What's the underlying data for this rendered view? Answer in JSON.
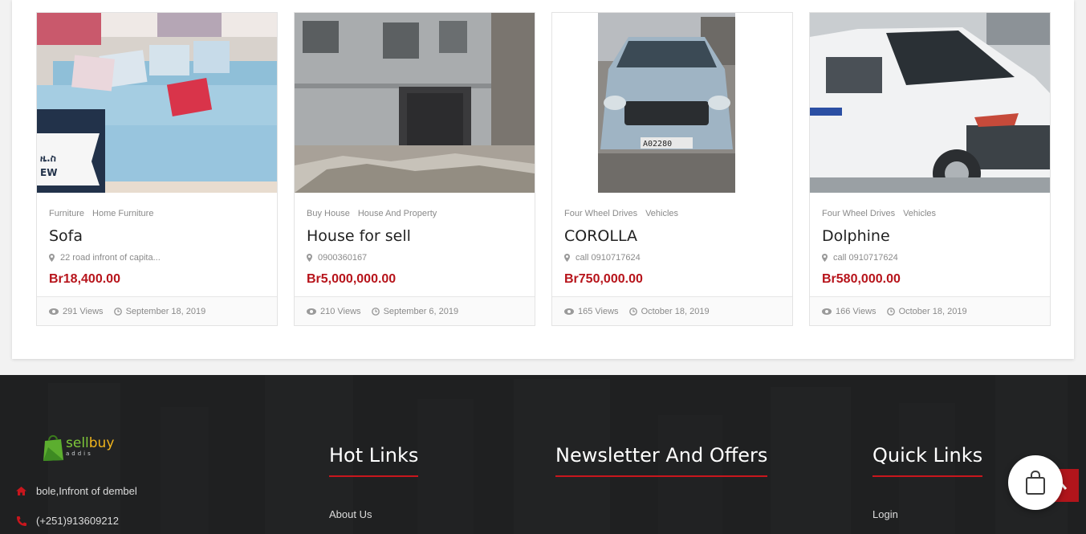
{
  "listings": [
    {
      "categories": [
        "Furniture",
        "Home Furniture"
      ],
      "title": "Sofa",
      "location": "22 road infront of capita...",
      "price": "Br18,400.00",
      "views": "291 Views",
      "date": "September 18, 2019",
      "image": "sofa-photo"
    },
    {
      "categories": [
        "Buy House",
        "House And Property"
      ],
      "title": "House for sell",
      "location": "0900360167",
      "price": "Br5,000,000.00",
      "views": "210 Views",
      "date": "September 6, 2019",
      "image": "house-photo"
    },
    {
      "categories": [
        "Four Wheel Drives",
        "Vehicles"
      ],
      "title": "COROLLA",
      "location": "call 0910717624",
      "price": "Br750,000.00",
      "views": "165 Views",
      "date": "October 18, 2019",
      "image": "corolla-photo"
    },
    {
      "categories": [
        "Four Wheel Drives",
        "Vehicles"
      ],
      "title": "Dolphine",
      "location": "call 0910717624",
      "price": "Br580,000.00",
      "views": "166 Views",
      "date": "October 18, 2019",
      "image": "van-photo"
    }
  ],
  "footer": {
    "logo": {
      "part1": "sell",
      "part2": "buy",
      "tagline": "addis"
    },
    "address": "bole,Infront of dembel",
    "phone": "(+251)913609212",
    "columns": {
      "hot_links": {
        "title": "Hot Links",
        "links": [
          "About Us"
        ]
      },
      "newsletter": {
        "title": "Newsletter And Offers"
      },
      "quick_links": {
        "title": "Quick Links",
        "links": [
          "Login"
        ]
      }
    }
  },
  "colors": {
    "accent": "#b7141b",
    "footer_bg": "#1f2021",
    "title_underline": "#c8161d"
  },
  "icons": {
    "views": "eye-icon",
    "date": "clock-icon",
    "location": "map-marker-icon",
    "address": "home-icon",
    "phone": "phone-icon",
    "back_to_top": "chevron-up-icon",
    "cart": "shopping-bag-icon"
  }
}
